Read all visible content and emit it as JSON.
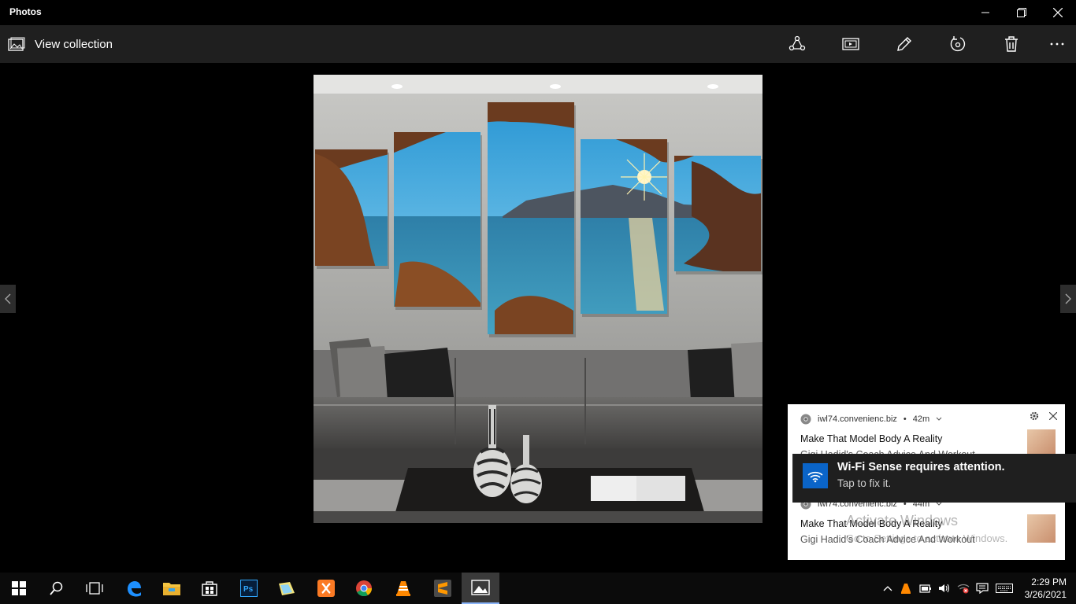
{
  "app": {
    "title": "Photos"
  },
  "toolbar": {
    "view_collection": "View collection"
  },
  "notifications": [
    {
      "source": "iwl74.convenienc.biz",
      "age": "42m",
      "title": "Make That Model Body A Reality",
      "body": "Gigi Hadid's Coach Advice And Workout"
    },
    {
      "source": "iwl74.convenienc.biz",
      "age": "44m",
      "title": "Make That Model Body A Reality",
      "body": "Gigi Hadid's Coach Advice And Workout"
    }
  ],
  "wifi_toast": {
    "title": "Wi-Fi Sense requires attention.",
    "subtitle": "Tap to fix it."
  },
  "watermark": {
    "line1": "Activate Windows",
    "line2": "Go to Settings to activate Windows."
  },
  "clock": {
    "time": "2:29 PM",
    "date": "3/26/2021"
  },
  "icons": {
    "toolbar": [
      "share-icon",
      "slideshow-icon",
      "edit-icon",
      "rotate-icon",
      "delete-icon",
      "more-icon"
    ],
    "taskbar": [
      "windows-start-icon",
      "search-icon",
      "task-view-icon",
      "edge-icon",
      "file-explorer-icon",
      "store-icon",
      "photoshop-icon",
      "photos-app-icon",
      "xampp-icon",
      "chrome-icon",
      "vlc-icon",
      "sublime-icon",
      "photos-icon"
    ]
  }
}
